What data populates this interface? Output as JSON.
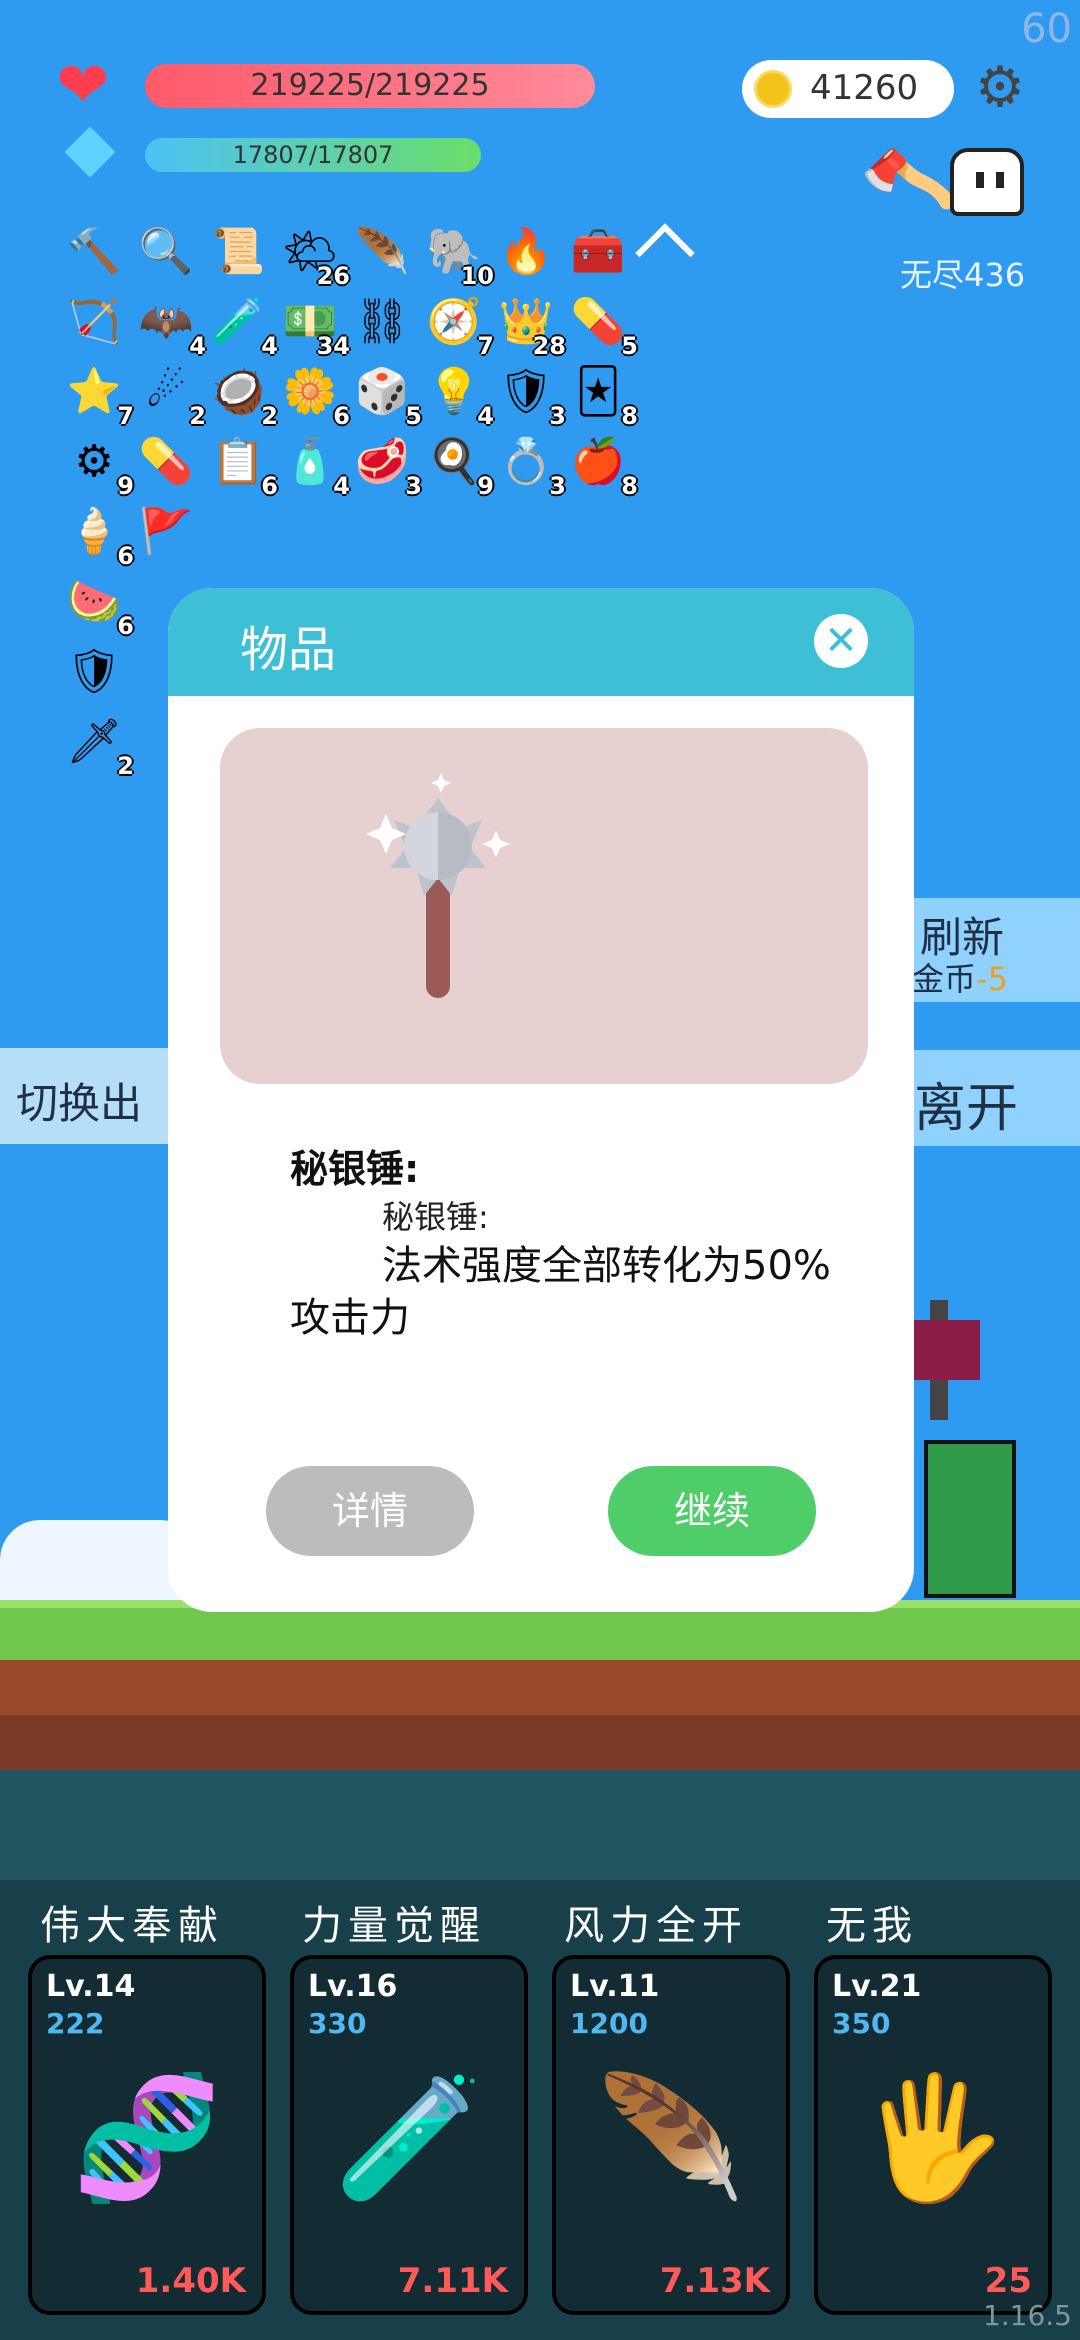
{
  "hud": {
    "hp_text": "219225/219225",
    "mp_text": "17807/17807",
    "coins": "41260",
    "fps": "60",
    "endless_label": "无尽436"
  },
  "items": [
    {
      "icon": "hammer-icon",
      "glyph": "🔨",
      "count": ""
    },
    {
      "icon": "magnifier-icon",
      "glyph": "🔍",
      "count": ""
    },
    {
      "icon": "scroll-icon",
      "glyph": "📜",
      "count": ""
    },
    {
      "icon": "sun-cloud-icon",
      "glyph": "🌤",
      "count": "26"
    },
    {
      "icon": "wing-icon",
      "glyph": "🪶",
      "count": ""
    },
    {
      "icon": "elephant-icon",
      "glyph": "🐘",
      "count": "10"
    },
    {
      "icon": "torch-icon",
      "glyph": "🔥",
      "count": ""
    },
    {
      "icon": "chest-icon",
      "glyph": "🧰",
      "count": ""
    },
    {
      "icon": "crossbow-icon",
      "glyph": "🏹",
      "count": ""
    },
    {
      "icon": "bat-icon",
      "glyph": "🦇",
      "count": "4"
    },
    {
      "icon": "potion-icon",
      "glyph": "🧪",
      "count": "4"
    },
    {
      "icon": "money-icon",
      "glyph": "💵",
      "count": "34"
    },
    {
      "icon": "chain-icon",
      "glyph": "⛓",
      "count": ""
    },
    {
      "icon": "compass-icon",
      "glyph": "🧭",
      "count": "7"
    },
    {
      "icon": "crown-icon",
      "glyph": "👑",
      "count": "28"
    },
    {
      "icon": "pill-icon",
      "glyph": "💊",
      "count": "5"
    },
    {
      "icon": "card-star-icon",
      "glyph": "⭐",
      "count": "7"
    },
    {
      "icon": "meteor-icon",
      "glyph": "☄",
      "count": "2"
    },
    {
      "icon": "coconut-icon",
      "glyph": "🥥",
      "count": "2"
    },
    {
      "icon": "flower-icon",
      "glyph": "🌼",
      "count": "6"
    },
    {
      "icon": "dice-icon",
      "glyph": "🎲",
      "count": "5"
    },
    {
      "icon": "bulb-icon",
      "glyph": "💡",
      "count": "4"
    },
    {
      "icon": "shield-round-icon",
      "glyph": "🛡",
      "count": "3"
    },
    {
      "icon": "cards-icon",
      "glyph": "🃏",
      "count": "8"
    },
    {
      "icon": "mace-icon",
      "glyph": "⚙",
      "count": "9"
    },
    {
      "icon": "capsule-icon",
      "glyph": "💊",
      "count": ""
    },
    {
      "icon": "clipboard-icon",
      "glyph": "📋",
      "count": "6"
    },
    {
      "icon": "bottle-icon",
      "glyph": "🧴",
      "count": "4"
    },
    {
      "icon": "meat-icon",
      "glyph": "🥩",
      "count": "3"
    },
    {
      "icon": "egg-icon",
      "glyph": "🍳",
      "count": "9"
    },
    {
      "icon": "ring-icon",
      "glyph": "💍",
      "count": "3"
    },
    {
      "icon": "apple-icon",
      "glyph": "🍎",
      "count": "8"
    },
    {
      "icon": "icecream-icon",
      "glyph": "🍦",
      "count": "6"
    },
    {
      "icon": "flag-icon",
      "glyph": "🚩",
      "count": ""
    },
    {
      "icon": "watermelon-icon",
      "glyph": "🍉",
      "count": "6"
    },
    {
      "icon": "shield-icon",
      "glyph": "🛡",
      "count": ""
    },
    {
      "icon": "weapon-card-icon",
      "glyph": "🗡",
      "count": "2"
    }
  ],
  "side": {
    "refresh_label": "刷新",
    "refresh_cost_label": "金币",
    "refresh_cost": "-5",
    "leave_label": "离开",
    "switch_label": "切换出"
  },
  "modal": {
    "title": "物品",
    "item_name": "秘银锤:",
    "desc_line1": "秘银锤:",
    "desc_line2": "法术强度全部转化为50%攻击力",
    "detail_label": "详情",
    "continue_label": "继续"
  },
  "skills": [
    {
      "title": "伟大奉献",
      "level": "Lv.14",
      "cost": "222",
      "value": "1.40K",
      "icon": "dna-icon",
      "glyph": "🧬"
    },
    {
      "title": "力量觉醒",
      "level": "Lv.16",
      "cost": "330",
      "value": "7.11K",
      "icon": "test-tube-icon",
      "glyph": "🧪"
    },
    {
      "title": "风力全开",
      "level": "Lv.11",
      "cost": "1200",
      "value": "7.13K",
      "icon": "feather-icon",
      "glyph": "🪶"
    },
    {
      "title": "无我",
      "level": "Lv.21",
      "cost": "350",
      "value": "25",
      "icon": "hand-eye-icon",
      "glyph": "🖐"
    }
  ],
  "version": "1.16.5",
  "colors": {
    "sky": "#2f9bf0",
    "modal_header": "#3dc0d6",
    "continue_button": "#4fcd68",
    "detail_button": "#bcbcbc",
    "skill_value": "#ff5a5a",
    "skill_cost": "#4fb8f2"
  }
}
